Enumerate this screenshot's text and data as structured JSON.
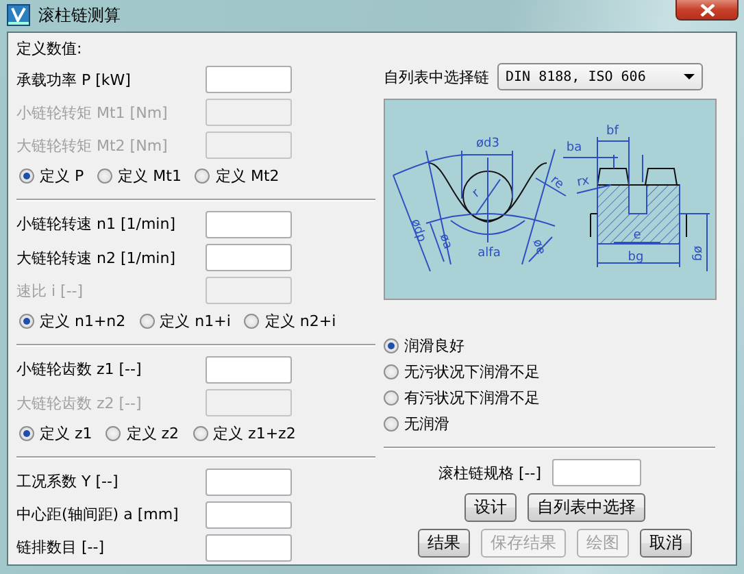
{
  "window": {
    "title": "滚柱链测算"
  },
  "heading": "定义数值:",
  "groups": [
    {
      "fields": [
        {
          "label": "承载功率 P [kW]",
          "disabled": false
        },
        {
          "label": "小链轮转矩 Mt1 [Nm]",
          "disabled": true
        },
        {
          "label": "大链轮转矩 Mt2 [Nm]",
          "disabled": true
        }
      ],
      "options": [
        {
          "label": "定义 P",
          "selected": true
        },
        {
          "label": "定义 Mt1",
          "selected": false
        },
        {
          "label": "定义 Mt2",
          "selected": false
        }
      ]
    },
    {
      "fields": [
        {
          "label": "小链轮转速 n1 [1/min]",
          "disabled": false
        },
        {
          "label": "大链轮转速 n2 [1/min]",
          "disabled": false
        },
        {
          "label": "速比 i [--]",
          "disabled": true
        }
      ],
      "options": [
        {
          "label": "定义 n1+n2",
          "selected": true
        },
        {
          "label": "定义 n1+i",
          "selected": false
        },
        {
          "label": "定义 n2+i",
          "selected": false
        }
      ]
    },
    {
      "fields": [
        {
          "label": "小链轮齿数 z1 [--]",
          "disabled": false
        },
        {
          "label": "大链轮齿数 z2 [--]",
          "disabled": true
        }
      ],
      "options": [
        {
          "label": "定义 z1",
          "selected": true
        },
        {
          "label": "定义 z2",
          "selected": false
        },
        {
          "label": "定义 z1+z2",
          "selected": false
        }
      ]
    },
    {
      "fields": [
        {
          "label": "工况系数 Y [--]",
          "disabled": false
        },
        {
          "label": "中心距(轴间距) a [mm]",
          "disabled": false
        },
        {
          "label": "链排数目 [--]",
          "disabled": false
        }
      ]
    }
  ],
  "chain_select": {
    "label": "自列表中选择链",
    "value": "DIN 8188, ISO 606"
  },
  "diagram": {
    "labels": [
      "ød3",
      "r",
      "re",
      "alfa",
      "ødp",
      "øa",
      "øe",
      "bf",
      "ba",
      "rx",
      "e",
      "bg",
      "øg"
    ]
  },
  "lubrication": [
    {
      "label": "润滑良好",
      "selected": true
    },
    {
      "label": "无污状况下润滑不足",
      "selected": false
    },
    {
      "label": "有污状况下润滑不足",
      "selected": false
    },
    {
      "label": "无润滑",
      "selected": false
    }
  ],
  "spec": {
    "label": "滚柱链规格 [--]"
  },
  "button_rows": [
    [
      {
        "label": "设计",
        "disabled": false
      },
      {
        "label": "自列表中选择",
        "disabled": false
      }
    ],
    [
      {
        "label": "结果",
        "disabled": false
      },
      {
        "label": "保存结果",
        "disabled": true
      },
      {
        "label": "绘图",
        "disabled": true
      },
      {
        "label": "取消",
        "disabled": false
      }
    ]
  ]
}
